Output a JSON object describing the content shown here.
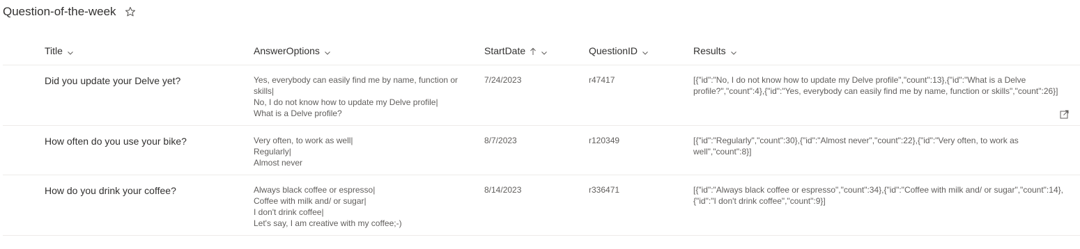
{
  "list": {
    "title": "Question-of-the-week"
  },
  "columns": {
    "title": "Title",
    "answer_options": "AnswerOptions",
    "start_date": "StartDate",
    "question_id": "QuestionID",
    "results": "Results"
  },
  "rows": [
    {
      "title": "Did you update your Delve yet?",
      "answer_options": [
        "Yes, everybody can easily find me by name, function or",
        "skills|",
        "No, I do not know how to update my Delve profile|",
        "What is a Delve profile?"
      ],
      "start_date": "7/24/2023",
      "question_id": "r47417",
      "results": "[{\"id\":\"No, I do not know how to update my Delve profile\",\"count\":13},{\"id\":\"What is a Delve profile?\",\"count\":4},{\"id\":\"Yes, everybody can easily find me by name, function or skills\",\"count\":26}]"
    },
    {
      "title": "How often do you use your bike?",
      "answer_options": [
        "Very often, to work as well|",
        "Regularly|",
        "Almost never"
      ],
      "start_date": "8/7/2023",
      "question_id": "r120349",
      "results": "[{\"id\":\"Regularly\",\"count\":30},{\"id\":\"Almost never\",\"count\":22},{\"id\":\"Very often, to work as well\",\"count\":8}]"
    },
    {
      "title": "How do you drink your coffee?",
      "answer_options": [
        "Always black coffee or espresso|",
        "Coffee with milk and/ or sugar|",
        "I don't drink coffee|",
        "Let's say, I am creative with my coffee;-)"
      ],
      "start_date": "8/14/2023",
      "question_id": "r336471",
      "results": "[{\"id\":\"Always black coffee or espresso\",\"count\":34},{\"id\":\"Coffee with milk and/ or sugar\",\"count\":14},{\"id\":\"I don't drink coffee\",\"count\":9}]"
    }
  ],
  "icons": {
    "favorite": "star-outline-icon",
    "sort": "arrow-up-icon",
    "column_menu": "chevron-down-icon",
    "open": "open-in-new-window-icon"
  }
}
